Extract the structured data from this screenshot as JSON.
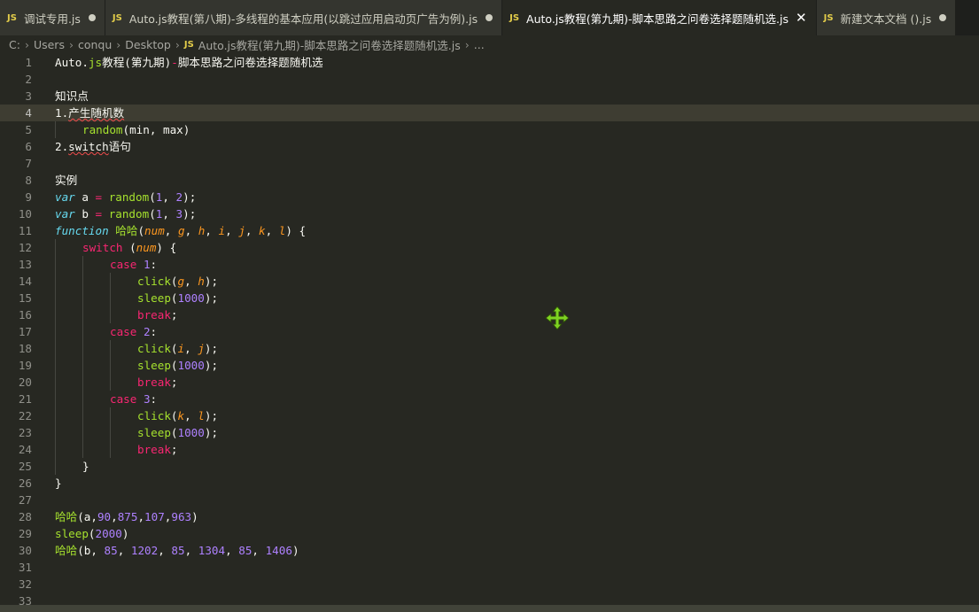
{
  "tabs": [
    {
      "icon": "JS",
      "label": "调试专用.js",
      "state": "dirty"
    },
    {
      "icon": "JS",
      "label": "Auto.js教程(第八期)-多线程的基本应用(以跳过应用启动页广告为例).js",
      "state": "dirty"
    },
    {
      "icon": "JS",
      "label": "Auto.js教程(第九期)-脚本思路之问卷选择题随机选.js",
      "state": "active"
    },
    {
      "icon": "JS",
      "label": "新建文本文档 ().js",
      "state": "dirty"
    }
  ],
  "breadcrumb": {
    "parts": [
      "C:",
      "Users",
      "conqu",
      "Desktop"
    ],
    "file_icon": "JS",
    "file": "Auto.js教程(第九期)-脚本思路之问卷选择题随机选.js",
    "more": "..."
  },
  "editor": {
    "current_line": 4,
    "lines": [
      {
        "n": "1",
        "i": 0,
        "t": [
          {
            "s": "Auto.",
            "c": "plain"
          },
          {
            "s": "js",
            "c": "fn"
          },
          {
            "s": "教程",
            "c": "plain"
          },
          {
            "s": "(第九期)",
            "c": "plain"
          },
          {
            "s": "-",
            "c": "op"
          },
          {
            "s": "脚本思路之问卷选择题随机选",
            "c": "plain"
          }
        ]
      },
      {
        "n": "2",
        "i": 0,
        "t": []
      },
      {
        "n": "3",
        "i": 0,
        "t": [
          {
            "s": "知识点",
            "c": "plain"
          }
        ]
      },
      {
        "n": "4",
        "i": 0,
        "t": [
          {
            "s": "1.",
            "c": "plain"
          },
          {
            "s": "产生随机数",
            "c": "squig"
          }
        ]
      },
      {
        "n": "5",
        "i": 1,
        "t": [
          {
            "s": "random",
            "c": "fn"
          },
          {
            "s": "(min, max)",
            "c": "plain"
          }
        ]
      },
      {
        "n": "6",
        "i": 0,
        "t": [
          {
            "s": "2.",
            "c": "plain"
          },
          {
            "s": "switch",
            "c": "squig"
          },
          {
            "s": "语句",
            "c": "plain"
          }
        ]
      },
      {
        "n": "7",
        "i": 0,
        "t": []
      },
      {
        "n": "8",
        "i": 0,
        "t": [
          {
            "s": "实例",
            "c": "plain"
          }
        ]
      },
      {
        "n": "9",
        "i": 0,
        "t": [
          {
            "s": "var",
            "c": "kw"
          },
          {
            "s": " a ",
            "c": "plain"
          },
          {
            "s": "=",
            "c": "op"
          },
          {
            "s": " ",
            "c": "plain"
          },
          {
            "s": "random",
            "c": "fn"
          },
          {
            "s": "(",
            "c": "plain"
          },
          {
            "s": "1",
            "c": "num"
          },
          {
            "s": ", ",
            "c": "plain"
          },
          {
            "s": "2",
            "c": "num"
          },
          {
            "s": ");",
            "c": "plain"
          }
        ]
      },
      {
        "n": "10",
        "i": 0,
        "t": [
          {
            "s": "var",
            "c": "kw"
          },
          {
            "s": " b ",
            "c": "plain"
          },
          {
            "s": "=",
            "c": "op"
          },
          {
            "s": " ",
            "c": "plain"
          },
          {
            "s": "random",
            "c": "fn"
          },
          {
            "s": "(",
            "c": "plain"
          },
          {
            "s": "1",
            "c": "num"
          },
          {
            "s": ", ",
            "c": "plain"
          },
          {
            "s": "3",
            "c": "num"
          },
          {
            "s": ");",
            "c": "plain"
          }
        ]
      },
      {
        "n": "11",
        "i": 0,
        "t": [
          {
            "s": "function",
            "c": "kw"
          },
          {
            "s": " ",
            "c": "plain"
          },
          {
            "s": "哈哈",
            "c": "fn"
          },
          {
            "s": "(",
            "c": "plain"
          },
          {
            "s": "num",
            "c": "param"
          },
          {
            "s": ", ",
            "c": "plain"
          },
          {
            "s": "g",
            "c": "param"
          },
          {
            "s": ", ",
            "c": "plain"
          },
          {
            "s": "h",
            "c": "param"
          },
          {
            "s": ", ",
            "c": "plain"
          },
          {
            "s": "i",
            "c": "param"
          },
          {
            "s": ", ",
            "c": "plain"
          },
          {
            "s": "j",
            "c": "param"
          },
          {
            "s": ", ",
            "c": "plain"
          },
          {
            "s": "k",
            "c": "param"
          },
          {
            "s": ", ",
            "c": "plain"
          },
          {
            "s": "l",
            "c": "param"
          },
          {
            "s": ") {",
            "c": "plain"
          }
        ]
      },
      {
        "n": "12",
        "i": 1,
        "t": [
          {
            "s": "switch",
            "c": "ctl"
          },
          {
            "s": " (",
            "c": "plain"
          },
          {
            "s": "num",
            "c": "param"
          },
          {
            "s": ") {",
            "c": "plain"
          }
        ]
      },
      {
        "n": "13",
        "i": 2,
        "t": [
          {
            "s": "case",
            "c": "ctl"
          },
          {
            "s": " ",
            "c": "plain"
          },
          {
            "s": "1",
            "c": "num"
          },
          {
            "s": ":",
            "c": "plain"
          }
        ]
      },
      {
        "n": "14",
        "i": 3,
        "t": [
          {
            "s": "click",
            "c": "fn"
          },
          {
            "s": "(",
            "c": "plain"
          },
          {
            "s": "g",
            "c": "param"
          },
          {
            "s": ", ",
            "c": "plain"
          },
          {
            "s": "h",
            "c": "param"
          },
          {
            "s": ");",
            "c": "plain"
          }
        ]
      },
      {
        "n": "15",
        "i": 3,
        "t": [
          {
            "s": "sleep",
            "c": "fn"
          },
          {
            "s": "(",
            "c": "plain"
          },
          {
            "s": "1000",
            "c": "num"
          },
          {
            "s": ");",
            "c": "plain"
          }
        ]
      },
      {
        "n": "16",
        "i": 3,
        "t": [
          {
            "s": "break",
            "c": "ctl"
          },
          {
            "s": ";",
            "c": "plain"
          }
        ]
      },
      {
        "n": "17",
        "i": 2,
        "t": [
          {
            "s": "case",
            "c": "ctl"
          },
          {
            "s": " ",
            "c": "plain"
          },
          {
            "s": "2",
            "c": "num"
          },
          {
            "s": ":",
            "c": "plain"
          }
        ]
      },
      {
        "n": "18",
        "i": 3,
        "t": [
          {
            "s": "click",
            "c": "fn"
          },
          {
            "s": "(",
            "c": "plain"
          },
          {
            "s": "i",
            "c": "param"
          },
          {
            "s": ", ",
            "c": "plain"
          },
          {
            "s": "j",
            "c": "param"
          },
          {
            "s": ");",
            "c": "plain"
          }
        ]
      },
      {
        "n": "19",
        "i": 3,
        "t": [
          {
            "s": "sleep",
            "c": "fn"
          },
          {
            "s": "(",
            "c": "plain"
          },
          {
            "s": "1000",
            "c": "num"
          },
          {
            "s": ");",
            "c": "plain"
          }
        ]
      },
      {
        "n": "20",
        "i": 3,
        "t": [
          {
            "s": "break",
            "c": "ctl"
          },
          {
            "s": ";",
            "c": "plain"
          }
        ]
      },
      {
        "n": "21",
        "i": 2,
        "t": [
          {
            "s": "case",
            "c": "ctl"
          },
          {
            "s": " ",
            "c": "plain"
          },
          {
            "s": "3",
            "c": "num"
          },
          {
            "s": ":",
            "c": "plain"
          }
        ]
      },
      {
        "n": "22",
        "i": 3,
        "t": [
          {
            "s": "click",
            "c": "fn"
          },
          {
            "s": "(",
            "c": "plain"
          },
          {
            "s": "k",
            "c": "param"
          },
          {
            "s": ", ",
            "c": "plain"
          },
          {
            "s": "l",
            "c": "param"
          },
          {
            "s": ");",
            "c": "plain"
          }
        ]
      },
      {
        "n": "23",
        "i": 3,
        "t": [
          {
            "s": "sleep",
            "c": "fn"
          },
          {
            "s": "(",
            "c": "plain"
          },
          {
            "s": "1000",
            "c": "num"
          },
          {
            "s": ");",
            "c": "plain"
          }
        ]
      },
      {
        "n": "24",
        "i": 3,
        "t": [
          {
            "s": "break",
            "c": "ctl"
          },
          {
            "s": ";",
            "c": "plain"
          }
        ]
      },
      {
        "n": "25",
        "i": 1,
        "t": [
          {
            "s": "}",
            "c": "plain"
          }
        ]
      },
      {
        "n": "26",
        "i": 0,
        "t": [
          {
            "s": "}",
            "c": "plain"
          }
        ]
      },
      {
        "n": "27",
        "i": 0,
        "t": []
      },
      {
        "n": "28",
        "i": 0,
        "t": [
          {
            "s": "哈哈",
            "c": "fn"
          },
          {
            "s": "(a,",
            "c": "plain"
          },
          {
            "s": "90",
            "c": "num"
          },
          {
            "s": ",",
            "c": "plain"
          },
          {
            "s": "875",
            "c": "num"
          },
          {
            "s": ",",
            "c": "plain"
          },
          {
            "s": "107",
            "c": "num"
          },
          {
            "s": ",",
            "c": "plain"
          },
          {
            "s": "963",
            "c": "num"
          },
          {
            "s": ")",
            "c": "plain"
          }
        ]
      },
      {
        "n": "29",
        "i": 0,
        "t": [
          {
            "s": "sleep",
            "c": "fn"
          },
          {
            "s": "(",
            "c": "plain"
          },
          {
            "s": "2000",
            "c": "num"
          },
          {
            "s": ")",
            "c": "plain"
          }
        ]
      },
      {
        "n": "30",
        "i": 0,
        "t": [
          {
            "s": "哈哈",
            "c": "fn"
          },
          {
            "s": "(b, ",
            "c": "plain"
          },
          {
            "s": "85",
            "c": "num"
          },
          {
            "s": ", ",
            "c": "plain"
          },
          {
            "s": "1202",
            "c": "num"
          },
          {
            "s": ", ",
            "c": "plain"
          },
          {
            "s": "85",
            "c": "num"
          },
          {
            "s": ", ",
            "c": "plain"
          },
          {
            "s": "1304",
            "c": "num"
          },
          {
            "s": ", ",
            "c": "plain"
          },
          {
            "s": "85",
            "c": "num"
          },
          {
            "s": ", ",
            "c": "plain"
          },
          {
            "s": "1406",
            "c": "num"
          },
          {
            "s": ")",
            "c": "plain"
          }
        ]
      },
      {
        "n": "31",
        "i": 0,
        "t": []
      },
      {
        "n": "32",
        "i": 0,
        "t": []
      },
      {
        "n": "33",
        "i": 0,
        "t": []
      }
    ]
  },
  "icons": {
    "cursor": "move-cursor-icon"
  },
  "colors": {
    "background": "#272822",
    "accent_cursor": "#7ed321"
  }
}
